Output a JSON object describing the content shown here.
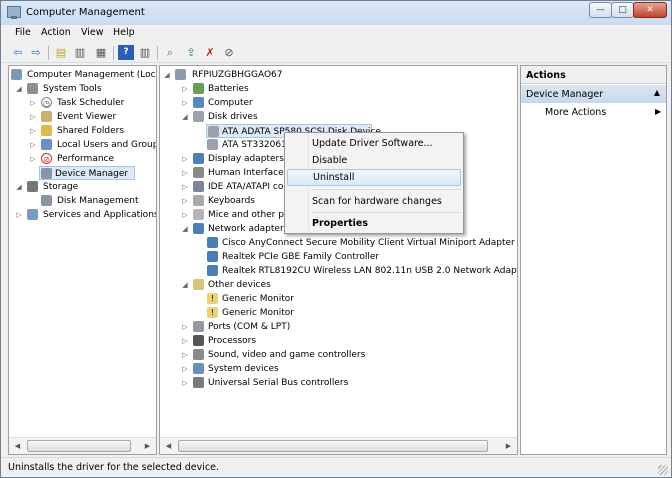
{
  "window": {
    "title": "Computer Management",
    "controls": {
      "minimize": "—",
      "maximize": "□",
      "close": "✕"
    }
  },
  "menubar": {
    "items": [
      "File",
      "Action",
      "View",
      "Help"
    ]
  },
  "toolbar": {
    "buttons": [
      {
        "icon": "back-arrow-icon",
        "glyph": "⇦"
      },
      {
        "icon": "forward-arrow-icon",
        "glyph": "⇨"
      },
      {
        "icon": "up-folder-icon",
        "glyph": "▤"
      },
      {
        "icon": "show-hide-tree-icon",
        "glyph": "▥"
      },
      {
        "icon": "export-list-icon",
        "glyph": "▦"
      },
      {
        "icon": "help-icon",
        "glyph": "?"
      },
      {
        "icon": "show-hide-action-pane-icon",
        "glyph": "▥"
      },
      {
        "icon": "scan-hardware-icon",
        "glyph": "⌕"
      },
      {
        "icon": "update-driver-icon",
        "glyph": "⇪"
      },
      {
        "icon": "uninstall-device-icon",
        "glyph": "✗"
      },
      {
        "icon": "disable-device-icon",
        "glyph": "⊘"
      }
    ]
  },
  "left_tree": {
    "root": "Computer Management (Local",
    "system_tools": "System Tools",
    "task_scheduler": "Task Scheduler",
    "event_viewer": "Event Viewer",
    "shared_folders": "Shared Folders",
    "local_users": "Local Users and Groups",
    "performance": "Performance",
    "device_manager": "Device Manager",
    "storage": "Storage",
    "disk_management": "Disk Management",
    "services": "Services and Applications"
  },
  "device_tree": {
    "computer_name": "RFPIUZGBHGGAO67",
    "batteries": "Batteries",
    "computer": "Computer",
    "disk_drives": "Disk drives",
    "disk1": "ATA ADATA SP580 SCSI Disk Device",
    "disk2": "ATA ST3320613",
    "display_adapters": "Display adapters",
    "hid": "Human Interface D",
    "ide": "IDE ATA/ATAPI co",
    "keyboards": "Keyboards",
    "mice": "Mice and other po",
    "network_adapters": "Network adapters",
    "net1": "Cisco AnyConnect Secure Mobility Client Virtual Miniport Adapter for W",
    "net2": "Realtek PCIe GBE Family Controller",
    "net3": "Realtek RTL8192CU Wireless LAN 802.11n USB 2.0 Network Adapter",
    "other_devices": "Other devices",
    "monitor1": "Generic Monitor",
    "monitor2": "Generic Monitor",
    "ports": "Ports (COM & LPT)",
    "processors": "Processors",
    "sound": "Sound, video and game controllers",
    "system_devices": "System devices",
    "usb": "Universal Serial Bus controllers"
  },
  "context_menu": {
    "update_driver": "Update Driver Software...",
    "disable": "Disable",
    "uninstall": "Uninstall",
    "scan": "Scan for hardware changes",
    "properties": "Properties"
  },
  "actions_pane": {
    "header": "Actions",
    "section": "Device Manager",
    "more_actions": "More Actions"
  },
  "statusbar": {
    "text": "Uninstalls the driver for the selected device."
  },
  "colors": {
    "selection_bg": "#dfe9f5",
    "context_hover": "#dde9f8",
    "actions_section_bg": "#c6d7ea"
  }
}
